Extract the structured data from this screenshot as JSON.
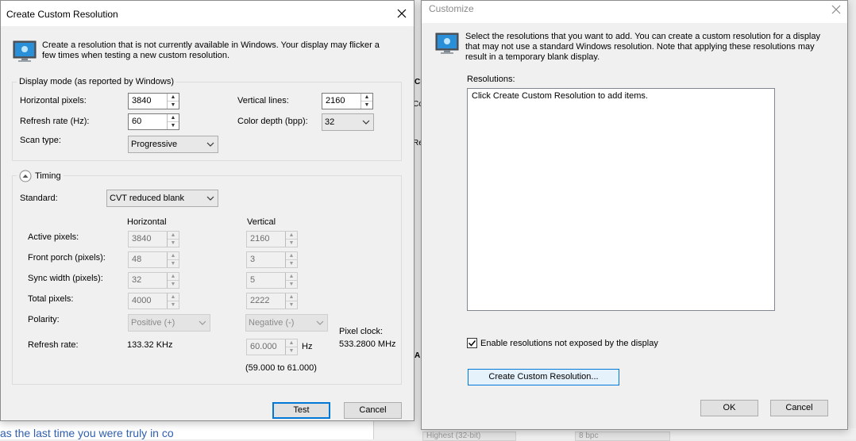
{
  "background": {
    "bottom_text": "as the last time you were truly in co",
    "right_frag_1": "Cl",
    "right_frag_2": "Co",
    "right_frag_3": "Re",
    "right_frag_4": "A",
    "bottom_select_1": "Highest (32-bit)",
    "bottom_select_2": "8 bpc"
  },
  "create_dialog": {
    "title": "Create Custom Resolution",
    "intro": "Create a resolution that is not currently available in Windows. Your display may flicker a few times when testing a new custom resolution.",
    "display_mode": {
      "caption": "Display mode (as reported by Windows)",
      "h_pixels_label": "Horizontal pixels:",
      "h_pixels_value": "3840",
      "v_lines_label": "Vertical lines:",
      "v_lines_value": "2160",
      "refresh_label": "Refresh rate (Hz):",
      "refresh_value": "60",
      "color_depth_label": "Color depth (bpp):",
      "color_depth_value": "32",
      "scan_label": "Scan type:",
      "scan_value": "Progressive"
    },
    "timing": {
      "caption": "Timing",
      "standard_label": "Standard:",
      "standard_value": "CVT reduced blank",
      "horizontal_header": "Horizontal",
      "vertical_header": "Vertical",
      "active_label": "Active pixels:",
      "active_h": "3840",
      "active_v": "2160",
      "front_label": "Front porch (pixels):",
      "front_h": "48",
      "front_v": "3",
      "sync_label": "Sync width (pixels):",
      "sync_h": "32",
      "sync_v": "5",
      "total_label": "Total pixels:",
      "total_h": "4000",
      "total_v": "2222",
      "polarity_label": "Polarity:",
      "polarity_h": "Positive (+)",
      "polarity_v": "Negative (-)",
      "pixel_clock_label": "Pixel clock:",
      "pixel_clock_value": "533.2800 MHz",
      "refresh_label": "Refresh rate:",
      "refresh_h": "133.32 KHz",
      "refresh_v": "60.000",
      "refresh_unit": "Hz",
      "range": "(59.000 to 61.000)"
    },
    "test_button": "Test",
    "cancel_button": "Cancel"
  },
  "customize_dialog": {
    "title": "Customize",
    "intro": "Select the resolutions that you want to add. You can create a custom resolution for a display that may not use a standard Windows resolution. Note that applying these resolutions may result in a temporary blank display.",
    "resolutions_label": "Resolutions:",
    "list_placeholder": "Click Create Custom Resolution to add items.",
    "checkbox_label": "Enable resolutions not exposed by the display",
    "checkbox_checked": true,
    "create_button": "Create Custom Resolution...",
    "ok_button": "OK",
    "cancel_button": "Cancel"
  },
  "colors": {
    "accent": "#0078d7",
    "link_blue": "#2f5fb0",
    "window_bg": "#f0f0f0"
  }
}
